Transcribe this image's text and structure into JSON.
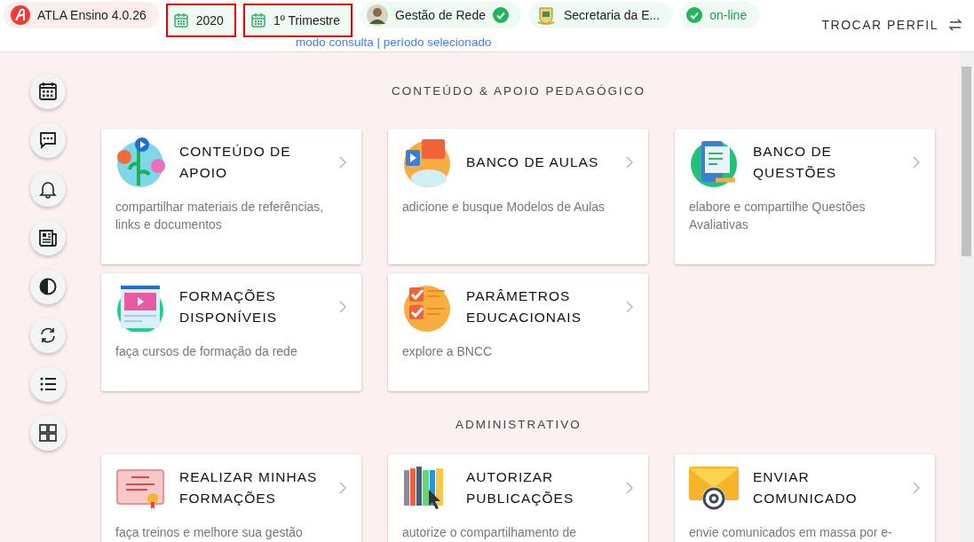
{
  "header": {
    "chips": [
      {
        "kind": "app",
        "label": "ATLA Ensino 4.0.26",
        "highlighted": false
      },
      {
        "kind": "calendar",
        "label": "2020",
        "highlighted": true
      },
      {
        "kind": "calendar",
        "label": "1º Trimestre",
        "highlighted": true
      },
      {
        "kind": "person",
        "label": "Gestão de Rede",
        "highlighted": false
      },
      {
        "kind": "crest",
        "label": "Secretaria da E...",
        "highlighted": false
      },
      {
        "kind": "status",
        "label": "on-line",
        "highlighted": false
      }
    ],
    "mode_link": "modo consulta | período selecionado",
    "switch_profile": "TROCAR PERFIL"
  },
  "sections": [
    {
      "title": "CONTEÚDO & APOIO PEDAGÓGICO",
      "cards": [
        {
          "title": "CONTEÚDO DE APOIO",
          "description": "compartilhar materiais de referências, links e documentos"
        },
        {
          "title": "BANCO DE AULAS",
          "description": "adicione e busque Modelos de Aulas"
        },
        {
          "title": "BANCO DE QUESTÕES",
          "description": "elabore e compartilhe Questões Avaliativas"
        },
        {
          "title": "FORMAÇÕES DISPONÍVEIS",
          "description": "faça cursos de formação da rede"
        },
        {
          "title": "PARÂMETROS EDUCACIONAIS",
          "description": "explore a BNCC"
        }
      ]
    },
    {
      "title": "ADMINISTRATIVO",
      "cards": [
        {
          "title": "REALIZAR MINHAS FORMAÇÕES",
          "description": "faça treinos e melhore sua gestão"
        },
        {
          "title": "AUTORIZAR PUBLICAÇÕES",
          "description": "autorize o compartilhamento de"
        },
        {
          "title": "ENVIAR COMUNICADO",
          "description": "envie comunicados em massa por e-"
        }
      ]
    }
  ]
}
